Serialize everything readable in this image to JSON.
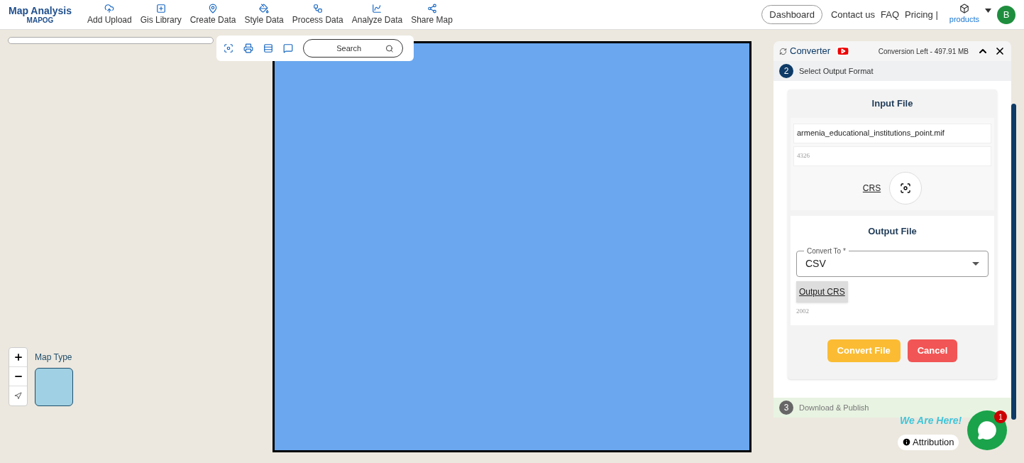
{
  "header": {
    "logo": {
      "title": "Map Analysis",
      "subtitle": "MAPOG"
    },
    "nav": [
      {
        "label": "Add Upload"
      },
      {
        "label": "Gis Library"
      },
      {
        "label": "Create Data"
      },
      {
        "label": "Style Data"
      },
      {
        "label": "Process Data"
      },
      {
        "label": "Analyze Data"
      },
      {
        "label": "Share Map"
      }
    ],
    "dashboard": "Dashboard",
    "links": [
      "Contact us",
      "FAQ",
      "Pricing |"
    ],
    "products": "products",
    "avatar": "B"
  },
  "map_toolbar": {
    "search": {
      "placeholder": "Search"
    }
  },
  "map_controls": {
    "map_type": "Map Type",
    "attribution": "Attribution"
  },
  "converter": {
    "title": "Converter",
    "conversion_left": "Conversion Left - 497.91 MB",
    "steps": [
      {
        "number": "2",
        "label": "Select Output Format",
        "active": true
      },
      {
        "number": "3",
        "label": "Download & Publish",
        "active": false
      }
    ],
    "input": {
      "heading": "Input File",
      "file_name": "armenia_educational_institutions_point.mif",
      "crs_code": "4326",
      "crs_label": "CRS"
    },
    "output": {
      "heading": "Output File",
      "convert_to_label": "Convert To *",
      "convert_to_value": "CSV",
      "output_crs": "Output CRS",
      "crs_code": "2002"
    },
    "buttons": [
      {
        "label": "Convert File",
        "kind": "primary"
      },
      {
        "label": "Cancel",
        "kind": "danger"
      }
    ]
  },
  "chat": {
    "banner": "We Are Here!",
    "badge": "1"
  }
}
